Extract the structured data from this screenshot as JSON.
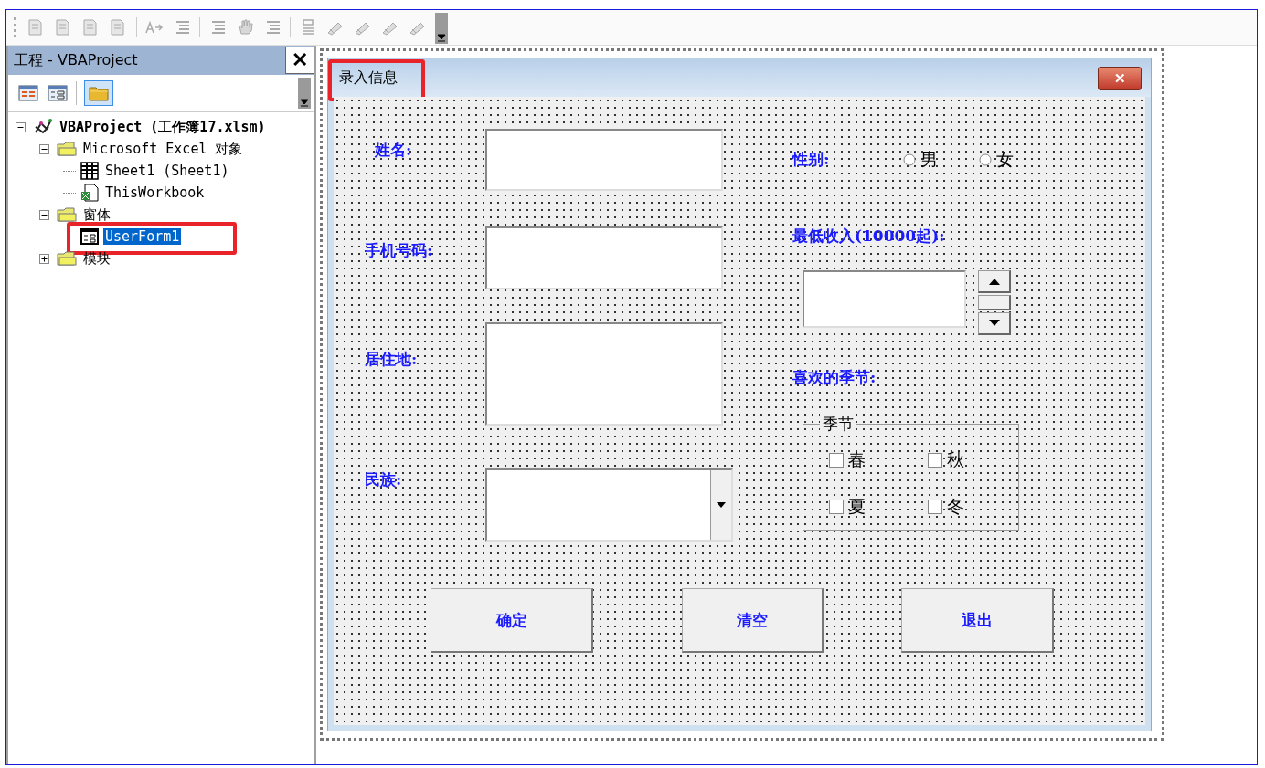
{
  "project_panel": {
    "title": "工程 - VBAProject",
    "close_label": "✕",
    "tree": [
      {
        "label": "VBAProject (工作簿17.xlsm)",
        "kind": "project",
        "expanded": true,
        "selected": false,
        "children": [
          {
            "label": "Microsoft Excel 对象",
            "kind": "folder",
            "expanded": true,
            "selected": false,
            "children": [
              {
                "label": "Sheet1 (Sheet1)",
                "kind": "sheet",
                "selected": false
              },
              {
                "label": "ThisWorkbook",
                "kind": "workbook",
                "selected": false
              }
            ]
          },
          {
            "label": "窗体",
            "kind": "folder",
            "expanded": true,
            "selected": false,
            "children": [
              {
                "label": "UserForm1",
                "kind": "form",
                "selected": true,
                "highlighted": true
              }
            ]
          },
          {
            "label": "模块",
            "kind": "folder",
            "expanded": false,
            "selected": false
          }
        ]
      }
    ]
  },
  "form": {
    "title": "录入信息",
    "title_highlighted": true,
    "close_label": "✕",
    "left_fields": [
      {
        "label": "姓名:",
        "kind": "text"
      },
      {
        "label": "手机号码:",
        "kind": "text"
      },
      {
        "label": "居住地:",
        "kind": "textarea"
      },
      {
        "label": "民族:",
        "kind": "combo"
      }
    ],
    "gender": {
      "label": "性别:",
      "options": [
        {
          "label": "男",
          "selected": false
        },
        {
          "label": "女",
          "selected": false
        }
      ]
    },
    "income": {
      "label": "最低收入(10000起):"
    },
    "seasons": {
      "label": "喜欢的季节:",
      "frame_caption": "季节",
      "options": [
        {
          "label": "春",
          "checked": false
        },
        {
          "label": "秋",
          "checked": false
        },
        {
          "label": "夏",
          "checked": false
        },
        {
          "label": "冬",
          "checked": false
        }
      ]
    },
    "buttons": [
      "确定",
      "清空",
      "退出"
    ]
  }
}
